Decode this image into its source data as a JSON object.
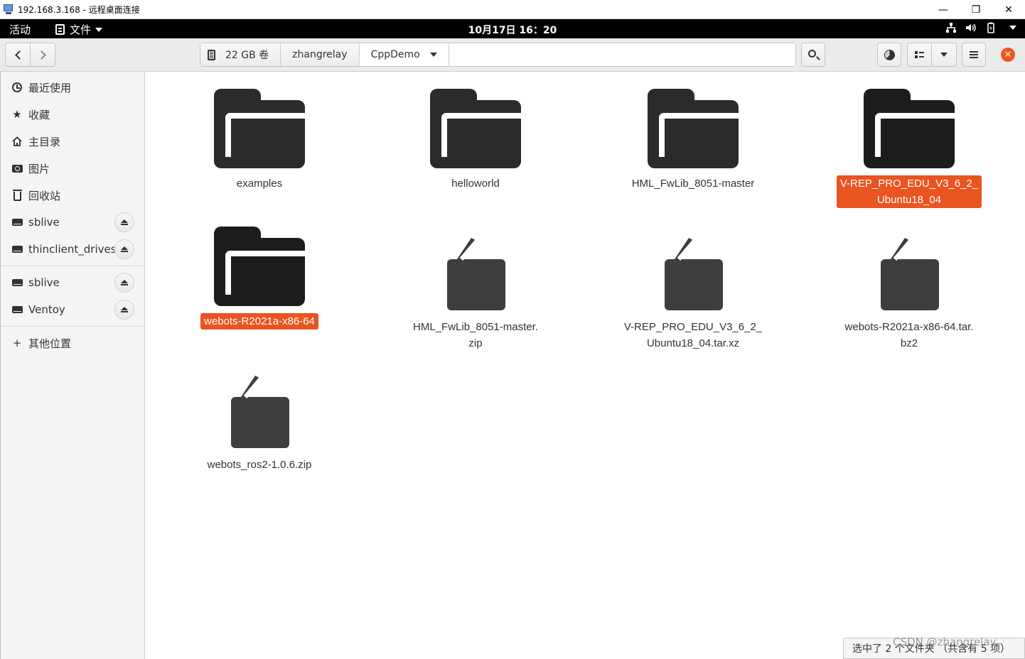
{
  "window": {
    "title": "192.168.3.168 - 远程桌面连接",
    "controls": {
      "minimize": "—",
      "restore": "❐",
      "close": "✕"
    }
  },
  "topbar": {
    "activities": "活动",
    "app_menu": "文件",
    "clock": "10月17日 16：20"
  },
  "header": {
    "back_icon": "chevron-left-icon",
    "forward_icon": "chevron-right-icon",
    "path": [
      {
        "label": "22 GB 卷",
        "icon": "disk-icon"
      },
      {
        "label": "zhangrelay"
      },
      {
        "label": "CppDemo",
        "current": true
      }
    ]
  },
  "sidebar": {
    "items": [
      {
        "label": "最近使用",
        "icon": "recent-icon"
      },
      {
        "label": "收藏",
        "icon": "star-icon"
      },
      {
        "label": "主目录",
        "icon": "home-icon"
      },
      {
        "label": "图片",
        "icon": "camera-icon"
      },
      {
        "label": "回收站",
        "icon": "trash-icon"
      }
    ],
    "drives_a": [
      {
        "label": "sblive",
        "icon": "drive-icon",
        "ejectable": true
      },
      {
        "label": "thinclient_drives",
        "icon": "drive-icon",
        "ejectable": true
      }
    ],
    "drives_b": [
      {
        "label": "sblive",
        "icon": "drive-icon",
        "ejectable": true
      },
      {
        "label": "Ventoy",
        "icon": "drive-icon",
        "ejectable": true
      }
    ],
    "other": {
      "label": "其他位置",
      "icon": "plus-icon"
    }
  },
  "files": [
    {
      "name": "examples",
      "type": "folder",
      "selected": false
    },
    {
      "name": "helloworld",
      "type": "folder",
      "selected": false
    },
    {
      "name": "HML_FwLib_8051-master",
      "type": "folder",
      "selected": false
    },
    {
      "name": "V-REP_PRO_EDU_V3_6_2_\nUbuntu18_04",
      "type": "folder",
      "selected": true
    },
    {
      "name": "webots-R2021a-x86-64",
      "type": "folder",
      "selected": true
    },
    {
      "name": "HML_FwLib_8051-master.\nzip",
      "type": "archive",
      "selected": false
    },
    {
      "name": "V-REP_PRO_EDU_V3_6_2_\nUbuntu18_04.tar.xz",
      "type": "archive",
      "selected": false
    },
    {
      "name": "webots-R2021a-x86-64.tar.\nbz2",
      "type": "archive",
      "selected": false
    },
    {
      "name": "webots_ros2-1.0.6.zip",
      "type": "archive",
      "selected": false
    }
  ],
  "status": {
    "text": "选中了 2 个文件夹 （共含有 5 项）"
  },
  "watermark": "CSDN @zhangrelay",
  "colors": {
    "selection": "#e95420",
    "close_button": "#f0541f",
    "folder": "#2a2b2c",
    "archive": "#3d3e3f"
  }
}
